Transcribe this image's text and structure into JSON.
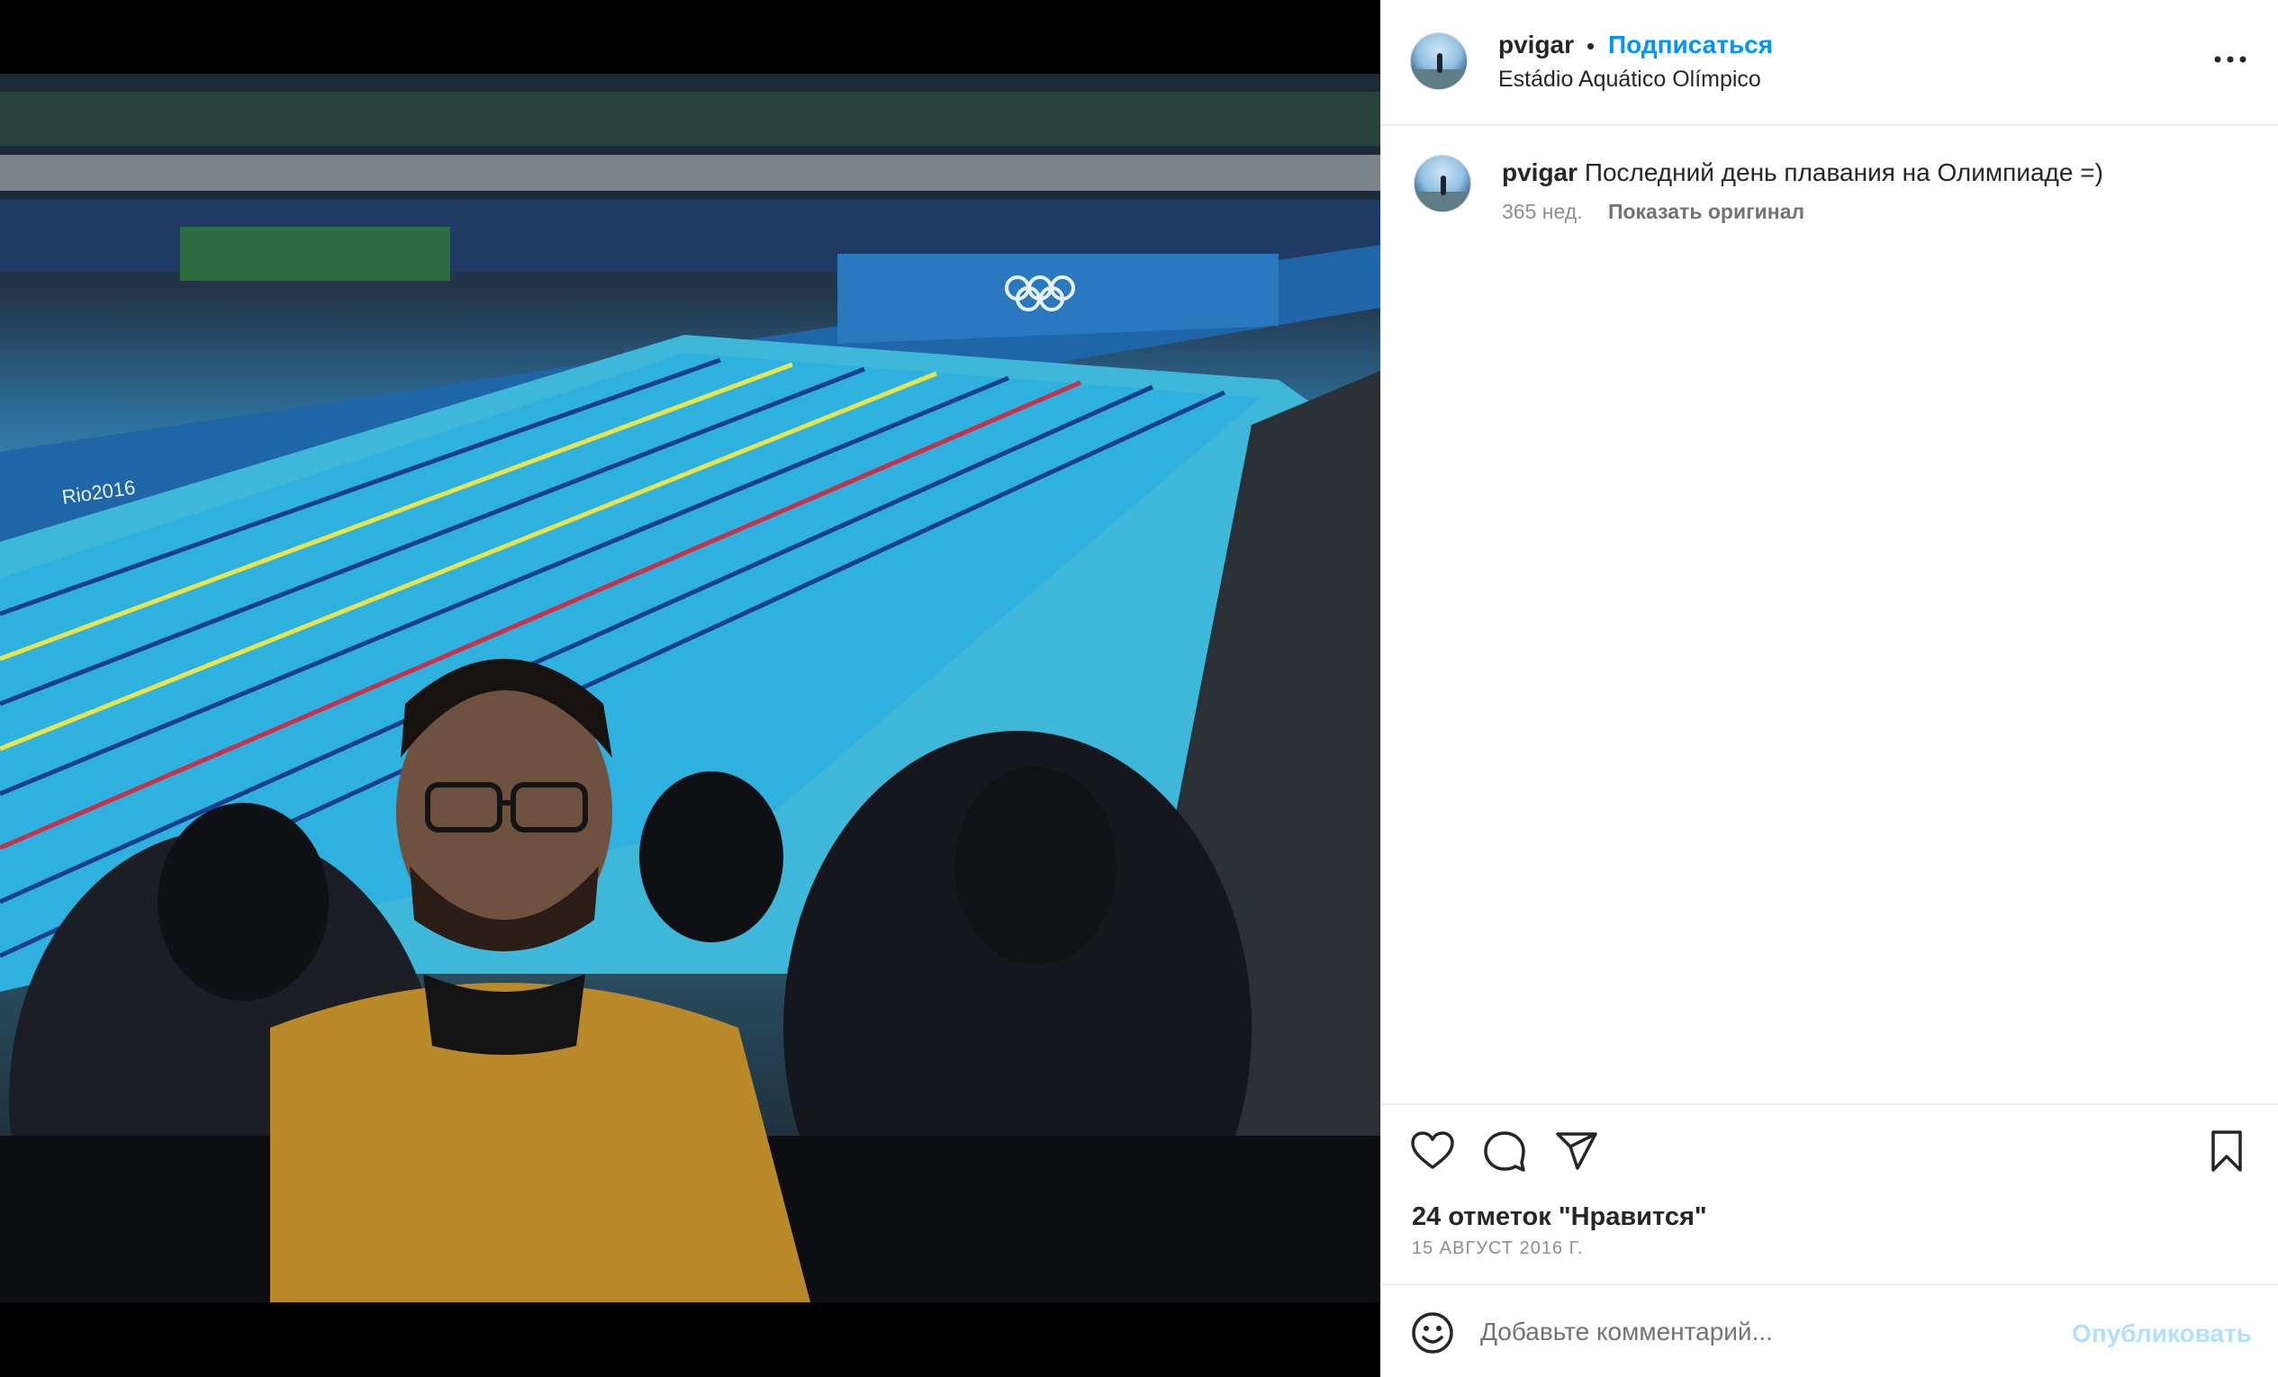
{
  "post": {
    "author": {
      "username": "pvigar",
      "follow_label": "Подписаться",
      "location": "Estádio Aquático Olímpico",
      "separator": "•"
    },
    "caption": {
      "username": "pvigar",
      "text": "Последний день плавания на Олимпиаде =)",
      "age": "365 нед.",
      "show_original_label": "Показать оригинал"
    },
    "likes_label": "24 отметок \"Нравится\"",
    "date_label": "15 АВГУСТ 2016 Г.",
    "comment": {
      "placeholder": "Добавьте комментарий...",
      "publish_label": "Опубликовать"
    }
  },
  "icons": {
    "more": "more-horizontal-icon",
    "like": "heart-icon",
    "comment": "comment-bubble-icon",
    "share": "send-paper-plane-icon",
    "save": "bookmark-icon",
    "emoji": "smiley-icon"
  },
  "colors": {
    "link": "#0095f6",
    "publish_disabled": "#b2dffc",
    "secondary_text": "#8e8e8e",
    "divider": "#efefef"
  },
  "photo": {
    "description_tags": [
      "olympic swimming pool",
      "spectators",
      "selfie"
    ],
    "signage": [
      "Rio2016"
    ]
  }
}
